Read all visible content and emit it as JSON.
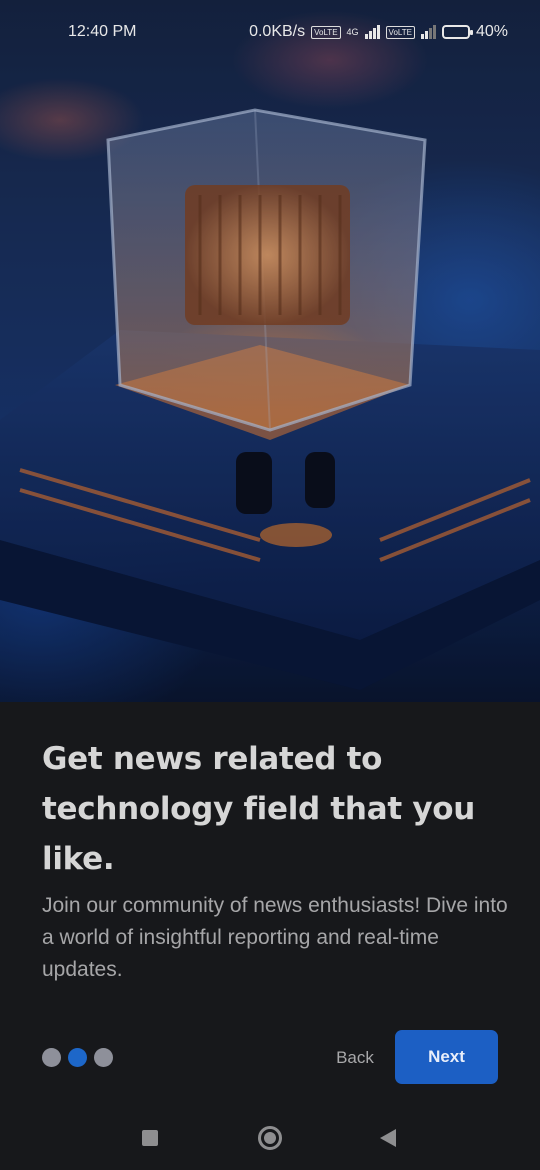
{
  "status_bar": {
    "time": "12:40 PM",
    "network_speed": "0.0KB/s",
    "network_type": "4G",
    "volte_label": "VoLTE",
    "battery_percent": "40%",
    "battery_level": 0.4
  },
  "hero": {
    "image": "glowing-processor-chip-on-circuit-board"
  },
  "onboarding": {
    "headline": "Get news related to technology field that you like.",
    "description": "Join our community of news enthusiasts! Dive into a world of insightful reporting and real-time updates.",
    "page_count": 3,
    "active_page": 2,
    "back_label": "Back",
    "next_label": "Next"
  },
  "nav_bar": {
    "icons": [
      "recents-icon",
      "home-icon",
      "back-icon"
    ]
  },
  "colors": {
    "background": "#17181b",
    "accent": "#1c5fc4",
    "dot_inactive": "#8e909a",
    "dot_active": "#1d67c9"
  }
}
